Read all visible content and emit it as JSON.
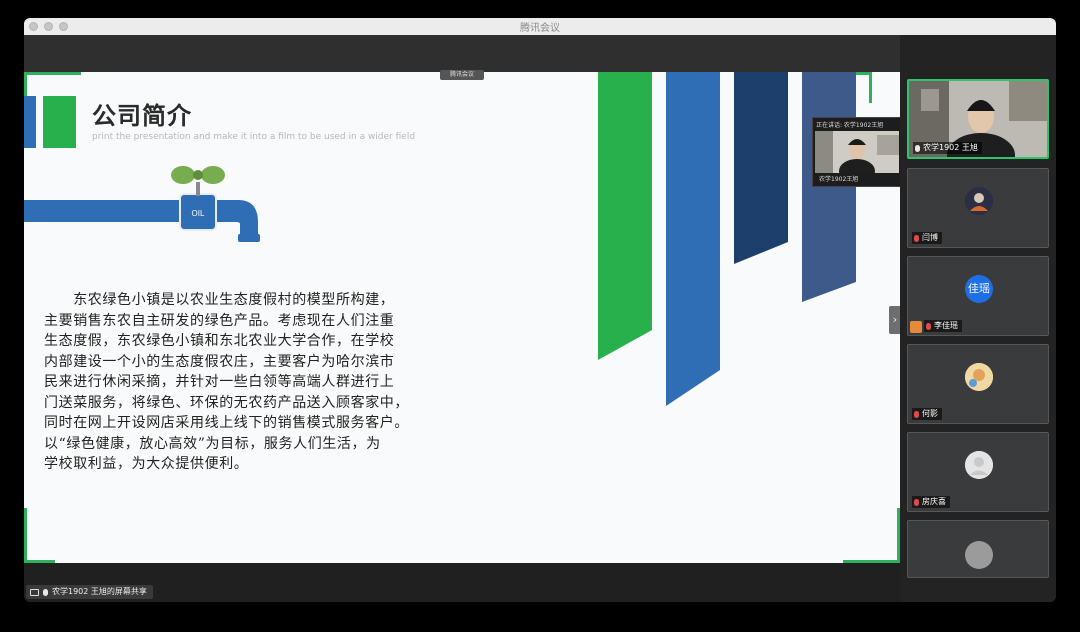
{
  "window": {
    "title": "腾讯会议"
  },
  "slide": {
    "title": "公司简介",
    "subtitle": "print the presentation and make it into a film to be used in a wider field",
    "valve_label": "OIL",
    "paragraphs": [
      "　　东农绿色小镇是以农业生态度假村的模型所构建，",
      "主要销售东农自主研发的绿色产品。考虑现在人们注重",
      "生态度假，东农绿色小镇和东北农业大学合作，在学校",
      "内部建设一个小的生态度假农庄，主要客户为哈尔滨市",
      "民来进行休闲采摘，并针对一些白领等高端人群进行上",
      "门送菜服务，将绿色、环保的无农药产品送入顾客家中，",
      "同时在网上开设网店采用线上线下的销售模式服务客户。",
      "以“绿色健康，放心高效”为目标，服务人们生活，为",
      "学校取利益，为大众提供便利。"
    ],
    "accent_green": "#28b04d",
    "accent_blue": "#2f6db4"
  },
  "overlay": {
    "tag": "腾讯会议",
    "speaker_header": "正在讲话: 农学1902王旭",
    "speaker_name": "农学1902王旭"
  },
  "participants": [
    {
      "name": "农学1902 王旭",
      "mic": "on",
      "active": true,
      "avatar": "video"
    },
    {
      "name": "闫博",
      "mic": "muted",
      "avatar": "photo-icon"
    },
    {
      "name": "李佳瑶",
      "mic": "muted",
      "avatar_text": "佳瑶",
      "avatar_color": "#1e6fe6"
    },
    {
      "name": "何影",
      "mic": "muted",
      "avatar": "photo-icon"
    },
    {
      "name": "房庆喜",
      "mic": "muted",
      "avatar": "default-icon"
    }
  ],
  "statusbar": {
    "share_label": "农学1902 王旭的屏幕共享"
  }
}
